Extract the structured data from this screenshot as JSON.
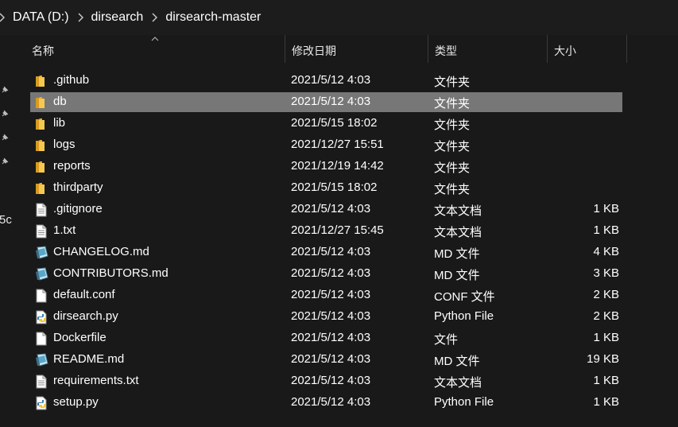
{
  "breadcrumb": [
    "DATA (D:)",
    "dirsearch",
    "dirsearch-master"
  ],
  "columns": {
    "name": "名称",
    "date": "修改日期",
    "type": "类型",
    "size": "大小"
  },
  "nav": {
    "partial_label": "5c"
  },
  "selected_index": 1,
  "files": [
    {
      "name": ".github",
      "date": "2021/5/12 4:03",
      "type": "文件夹",
      "size": "",
      "icon": "folder-icon"
    },
    {
      "name": "db",
      "date": "2021/5/12 4:03",
      "type": "文件夹",
      "size": "",
      "icon": "folder-icon"
    },
    {
      "name": "lib",
      "date": "2021/5/15 18:02",
      "type": "文件夹",
      "size": "",
      "icon": "folder-icon"
    },
    {
      "name": "logs",
      "date": "2021/12/27 15:51",
      "type": "文件夹",
      "size": "",
      "icon": "folder-icon"
    },
    {
      "name": "reports",
      "date": "2021/12/19 14:42",
      "type": "文件夹",
      "size": "",
      "icon": "folder-icon"
    },
    {
      "name": "thirdparty",
      "date": "2021/5/15 18:02",
      "type": "文件夹",
      "size": "",
      "icon": "folder-icon"
    },
    {
      "name": ".gitignore",
      "date": "2021/5/12 4:03",
      "type": "文本文档",
      "size": "1 KB",
      "icon": "text-file-icon"
    },
    {
      "name": "1.txt",
      "date": "2021/12/27 15:45",
      "type": "文本文档",
      "size": "1 KB",
      "icon": "text-file-icon"
    },
    {
      "name": "CHANGELOG.md",
      "date": "2021/5/12 4:03",
      "type": "MD 文件",
      "size": "4 KB",
      "icon": "markdown-file-icon"
    },
    {
      "name": "CONTRIBUTORS.md",
      "date": "2021/5/12 4:03",
      "type": "MD 文件",
      "size": "3 KB",
      "icon": "markdown-file-icon"
    },
    {
      "name": "default.conf",
      "date": "2021/5/12 4:03",
      "type": "CONF 文件",
      "size": "2 KB",
      "icon": "blank-file-icon"
    },
    {
      "name": "dirsearch.py",
      "date": "2021/5/12 4:03",
      "type": "Python File",
      "size": "2 KB",
      "icon": "python-file-icon"
    },
    {
      "name": "Dockerfile",
      "date": "2021/5/12 4:03",
      "type": "文件",
      "size": "1 KB",
      "icon": "blank-file-icon"
    },
    {
      "name": "README.md",
      "date": "2021/5/12 4:03",
      "type": "MD 文件",
      "size": "19 KB",
      "icon": "markdown-file-icon"
    },
    {
      "name": "requirements.txt",
      "date": "2021/5/12 4:03",
      "type": "文本文档",
      "size": "1 KB",
      "icon": "text-file-icon"
    },
    {
      "name": "setup.py",
      "date": "2021/5/12 4:03",
      "type": "Python File",
      "size": "1 KB",
      "icon": "python-file-icon"
    }
  ]
}
